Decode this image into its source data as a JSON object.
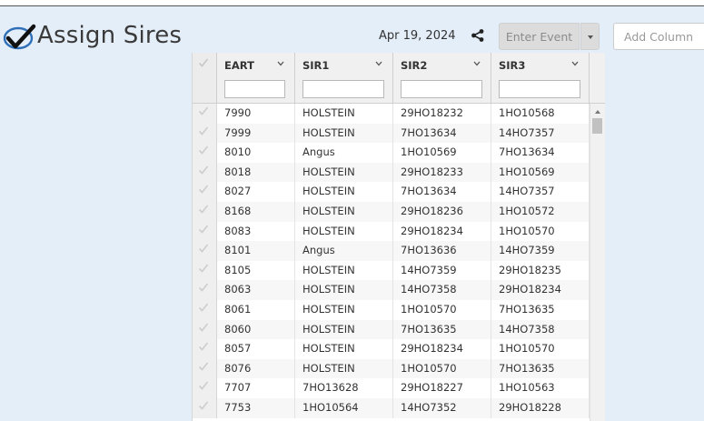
{
  "header": {
    "title": "Assign Sires",
    "date": "Apr 19, 2024",
    "event_button": "Enter Event",
    "add_column_placeholder": "Add Column"
  },
  "grid": {
    "columns": [
      {
        "key": "eart",
        "label": "EART"
      },
      {
        "key": "sir1",
        "label": "SIR1"
      },
      {
        "key": "sir2",
        "label": "SIR2"
      },
      {
        "key": "sir3",
        "label": "SIR3"
      }
    ],
    "rows": [
      [
        "7990",
        "HOLSTEIN",
        "29HO18232",
        "1HO10568"
      ],
      [
        "7999",
        "HOLSTEIN",
        "7HO13634",
        "14HO7357"
      ],
      [
        "8010",
        "Angus",
        "1HO10569",
        "7HO13634"
      ],
      [
        "8018",
        "HOLSTEIN",
        "29HO18233",
        "1HO10569"
      ],
      [
        "8027",
        "HOLSTEIN",
        "7HO13634",
        "14HO7357"
      ],
      [
        "8168",
        "HOLSTEIN",
        "29HO18236",
        "1HO10572"
      ],
      [
        "8083",
        "HOLSTEIN",
        "29HO18234",
        "1HO10570"
      ],
      [
        "8101",
        "Angus",
        "7HO13636",
        "14HO7359"
      ],
      [
        "8105",
        "HOLSTEIN",
        "14HO7359",
        "29HO18235"
      ],
      [
        "8063",
        "HOLSTEIN",
        "14HO7358",
        "29HO18234"
      ],
      [
        "8061",
        "HOLSTEIN",
        "1HO10570",
        "7HO13635"
      ],
      [
        "8060",
        "HOLSTEIN",
        "7HO13635",
        "14HO7358"
      ],
      [
        "8057",
        "HOLSTEIN",
        "29HO18234",
        "1HO10570"
      ],
      [
        "8076",
        "HOLSTEIN",
        "1HO10570",
        "7HO13635"
      ],
      [
        "7707",
        "7HO13628",
        "29HO18227",
        "1HO10563"
      ],
      [
        "7753",
        "1HO10564",
        "14HO7352",
        "29HO18228"
      ]
    ]
  },
  "colors": {
    "background": "#e4eef9",
    "logo_blue": "#2f6fb8",
    "check_gray": "#d2d2d2"
  }
}
